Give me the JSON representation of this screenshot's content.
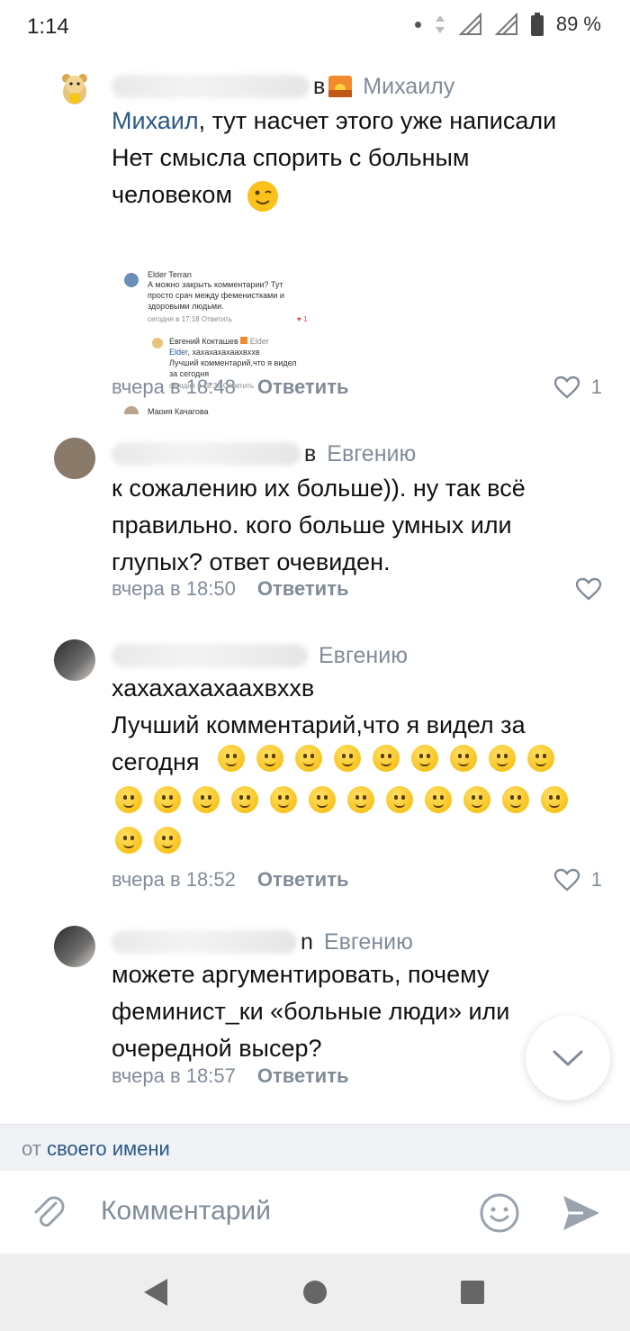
{
  "status_bar": {
    "time": "1:14",
    "battery": "89 %"
  },
  "comments": [
    {
      "name_tail": "в",
      "reply_to": "Михаилу",
      "mention": "Михаил",
      "line1_rest": ", тут насчет этого уже написали",
      "line2": "Нет смысла спорить с больным",
      "line3": "человеком",
      "time": "вчера в 18:48",
      "reply": "Ответить",
      "likes": "1",
      "screenshot": {
        "c1_name": "Elder Terran",
        "c1_l1": "А можно закрыть комментарии? Тут",
        "c1_l2": "просто срач между феменистками и",
        "c1_l3": "здоровыми людьми.",
        "c1_meta": "сегодня в 17:18   Ответить",
        "c1_likes": "1",
        "c2_name": "Евгений Кокташев",
        "c2_reply_to": "Elder",
        "c2_mention": "Elder",
        "c2_l1": ", хахахахахаахвххв",
        "c2_l2": "Лучший комментарий,что я видел",
        "c2_l3": "за сегодня",
        "c2_meta": "сегодня в 18:36   Ответить",
        "c3_name": "Мария Качагова"
      }
    },
    {
      "name_tail": "в",
      "reply_to": "Евгению",
      "line1": "к сожалению их больше)). ну так всё",
      "line2": "правильно. кого больше умных или",
      "line3": "глупых? ответ очевиден.",
      "time": "вчера в 18:50",
      "reply": "Ответить"
    },
    {
      "reply_to": "Евгению",
      "line1": "хахахахахаахвххв",
      "line2": "Лучший комментарий,что я видел за",
      "line3": "сегодня",
      "time": "вчера в 18:52",
      "reply": "Ответить",
      "likes": "1"
    },
    {
      "name_tail": "n",
      "reply_to": "Евгению",
      "line1": "можете аргументировать, почему",
      "line2": "феминист_ки «больные люди» или",
      "line3": "очередной высер?",
      "time": "вчера в 18:57",
      "reply": "Ответить"
    }
  ],
  "from_bar": {
    "prefix": "от",
    "link": "своего имени"
  },
  "input": {
    "placeholder": "Комментарий"
  }
}
